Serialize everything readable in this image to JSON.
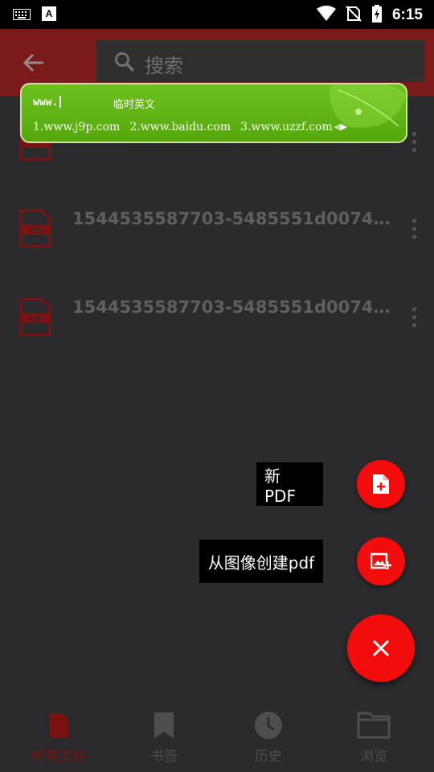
{
  "status_bar": {
    "time": "6:15",
    "icons": [
      "keyboard-icon",
      "a-font-icon",
      "wifi-icon",
      "no-sim-icon",
      "battery-charging-icon"
    ]
  },
  "app_bar": {
    "back_icon": "arrow-left-icon",
    "search": {
      "placeholder": "搜索",
      "icon": "search-icon"
    }
  },
  "ime": {
    "composing": "www.",
    "mode": "临时英文",
    "candidates": [
      "1.www.j9p.com",
      "2.www.baidu.com",
      "3.www.uzzf.com"
    ]
  },
  "files": [
    {
      "name": "",
      "icon": "pdf-file-icon"
    },
    {
      "name": "1544535587703-5485551d007440...",
      "icon": "pdf-file-icon"
    },
    {
      "name": "1544535587703-5485551d007440...",
      "icon": "pdf-file-icon"
    }
  ],
  "fab_menu": {
    "new_pdf_label": "新 PDF",
    "from_image_label": "从图像创建pdf",
    "close_icon": "close-icon"
  },
  "bottom_nav": [
    {
      "label": "所有文件",
      "icon": "file-icon",
      "active": true
    },
    {
      "label": "书签",
      "icon": "bookmark-icon",
      "active": false
    },
    {
      "label": "历史",
      "icon": "clock-icon",
      "active": false
    },
    {
      "label": "浏览",
      "icon": "folder-icon",
      "active": false
    }
  ],
  "colors": {
    "accent": "#f20c0c",
    "app_bar_dimmed": "#7a1a1a",
    "background": "#2b2b2d",
    "ime_green": "#5bb313"
  }
}
